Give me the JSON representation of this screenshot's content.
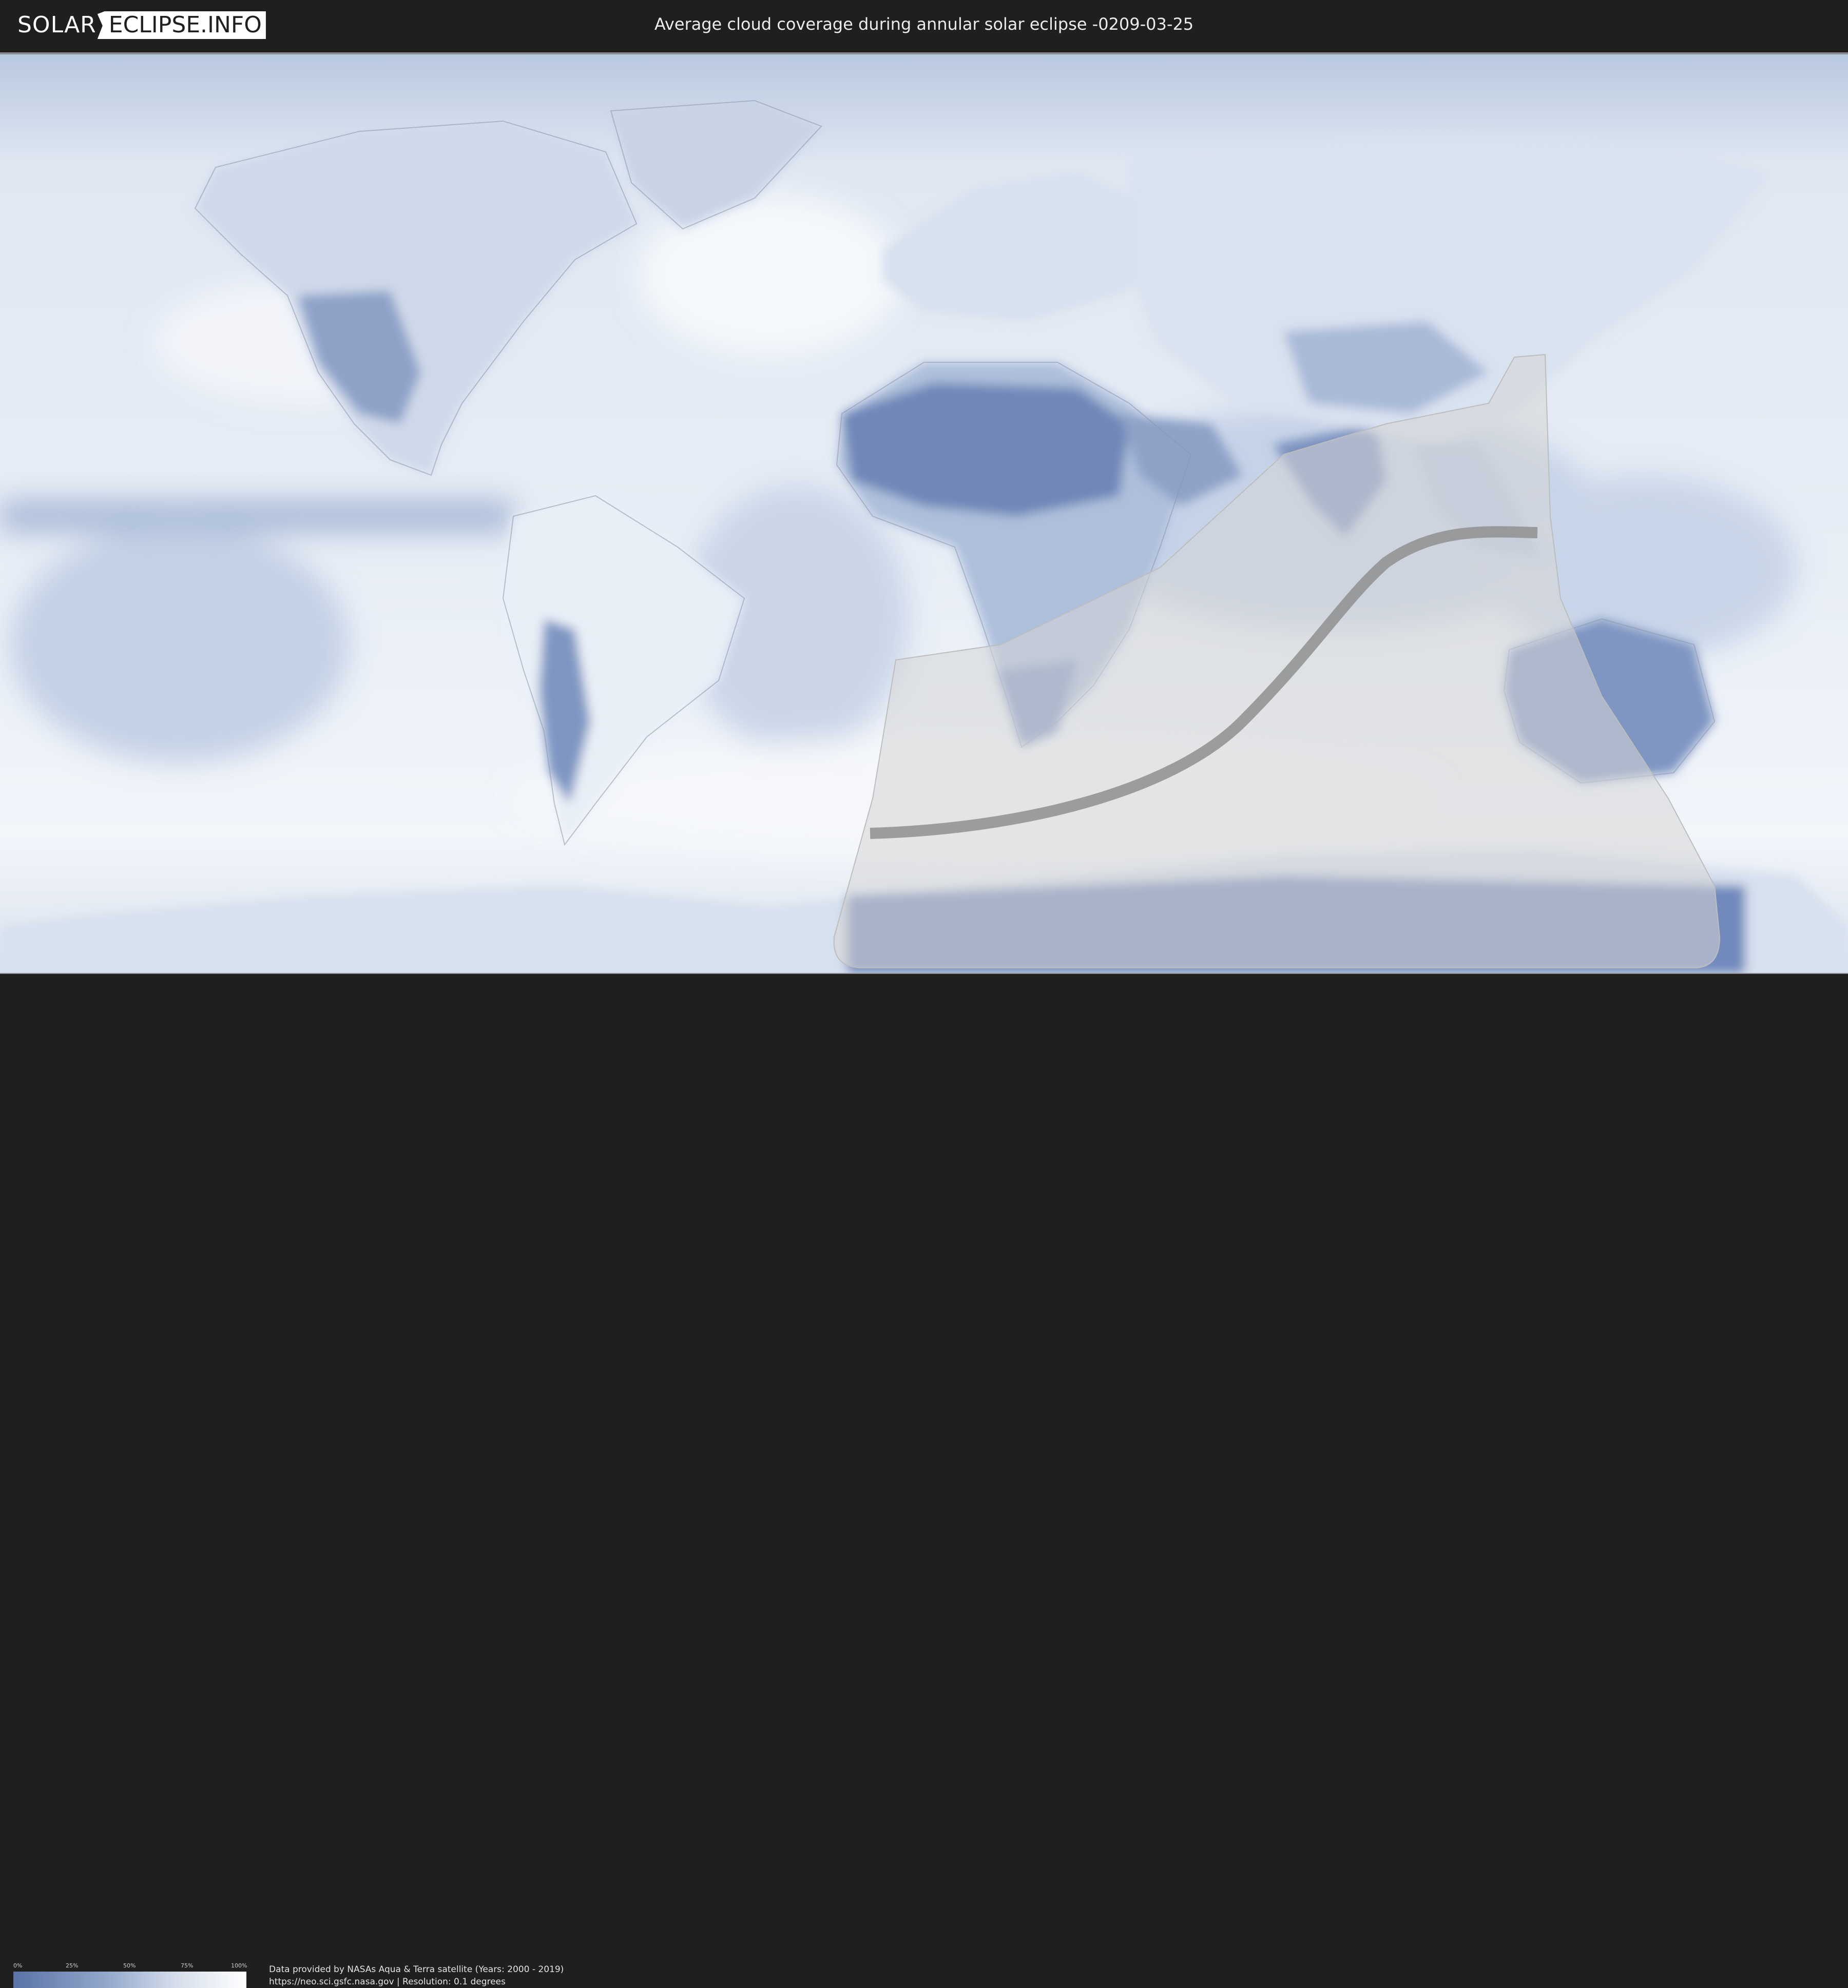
{
  "header": {
    "logo_left": "SOLAR",
    "logo_right": "ECLIPSE.INFO",
    "title": "Average cloud coverage during annular solar eclipse -0209-03-25"
  },
  "legend": {
    "ticks": [
      "0%",
      "25%",
      "50%",
      "75%",
      "100%"
    ],
    "gradient_colors": [
      "#5a73a6",
      "#93a8cc",
      "#d6deeb",
      "#ffffff"
    ]
  },
  "footer": {
    "credit_line1": "Data provided by NASAs Aqua & Terra satellite (Years: 2000 - 2019)",
    "credit_line2": "https://neo.sci.gsfc.nasa.gov | Resolution: 0.1 degrees"
  },
  "map": {
    "colors": {
      "ocean_cloudy": "#e9eff7",
      "clear_sky": "#5b76aa",
      "eclipse_visibility_region": "#d8d8d8",
      "central_path": "#8f8f8f"
    }
  }
}
